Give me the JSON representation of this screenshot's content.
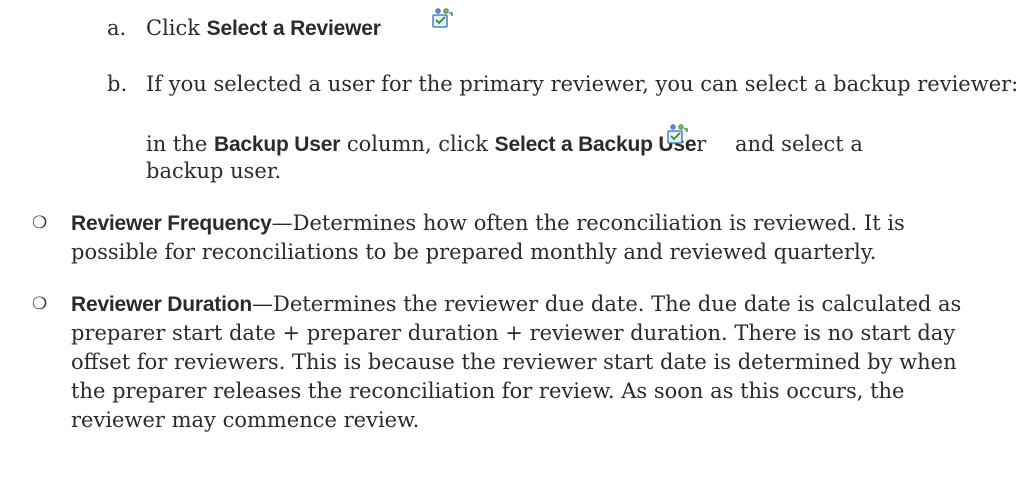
{
  "steps": {
    "a": {
      "marker": "a.",
      "text": "Click ",
      "strong": "Select a Reviewer",
      "icon": "select-user-icon"
    },
    "b": {
      "marker": "b.",
      "line1": "If you selected a user for the primary reviewer, you can select a backup reviewer:",
      "line2_pre": "in the ",
      "line2_strong1": "Backup User",
      "line2_mid": " column, click ",
      "line2_strong2": "Select a Backup Use",
      "line2_after": "r",
      "line2_end": "and select a",
      "line3": "backup user.",
      "icon": "select-user-icon"
    }
  },
  "bullets": [
    {
      "marker": "❍",
      "term": "Reviewer Frequency",
      "line1": "—Determines how often the reconciliation is reviewed. It is",
      "line2": "possible for reconciliations to be prepared monthly and reviewed quarterly."
    },
    {
      "marker": "❍",
      "term": "Reviewer Duration",
      "line1": "—Determines the reviewer due date. The due date is calculated as",
      "line2": "preparer start date + preparer duration + reviewer duration. There is no start day",
      "line3": "offset for reviewers. This is because the reviewer start date is determined by when",
      "line4": "the preparer releases the reconciliation for review. As soon as this occurs, the",
      "line5": "reviewer may commence review."
    }
  ],
  "colors": {
    "text": "#2b2b2b",
    "icon_blue": "#2f6fb3",
    "icon_green": "#3c9a3c"
  }
}
